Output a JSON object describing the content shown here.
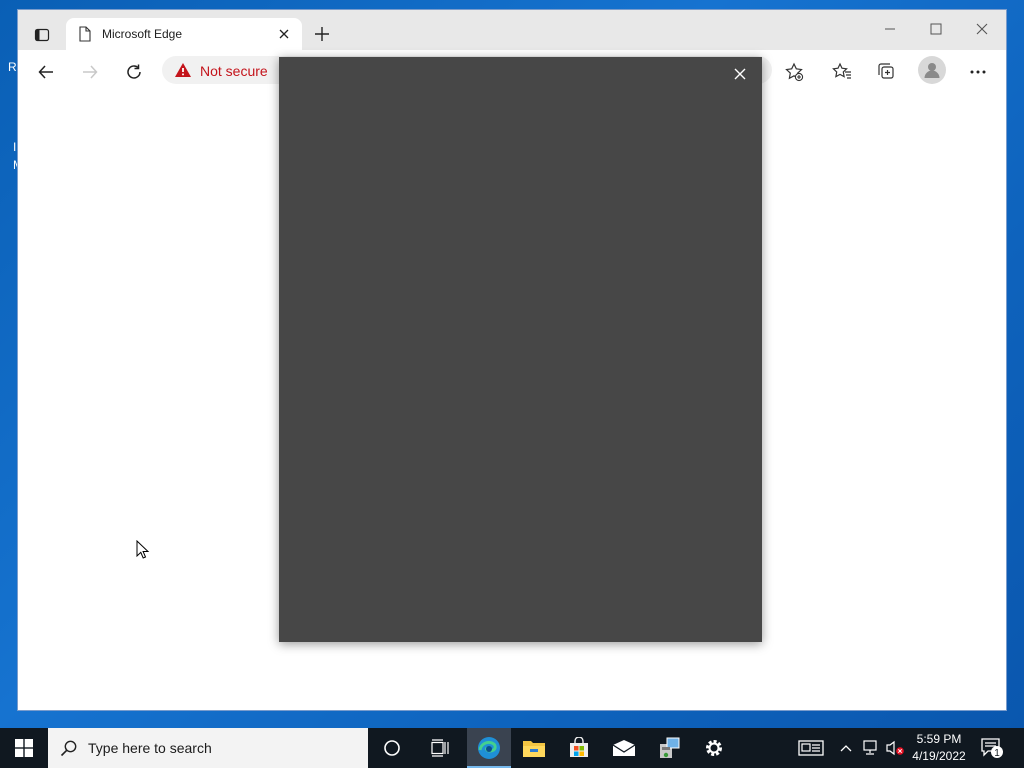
{
  "window": {
    "tab_title": "Microsoft Edge",
    "security_label": "Not secure"
  },
  "taskbar": {
    "search_placeholder": "Type here to search",
    "time": "5:59 PM",
    "date": "4/19/2022",
    "notification_count": "1"
  },
  "desktop": {
    "icon_fragments": [
      "R",
      "I",
      "M"
    ]
  },
  "colors": {
    "warning_red": "#c4141b",
    "popup_bg": "#474747",
    "taskbar_bg": "#101820"
  }
}
